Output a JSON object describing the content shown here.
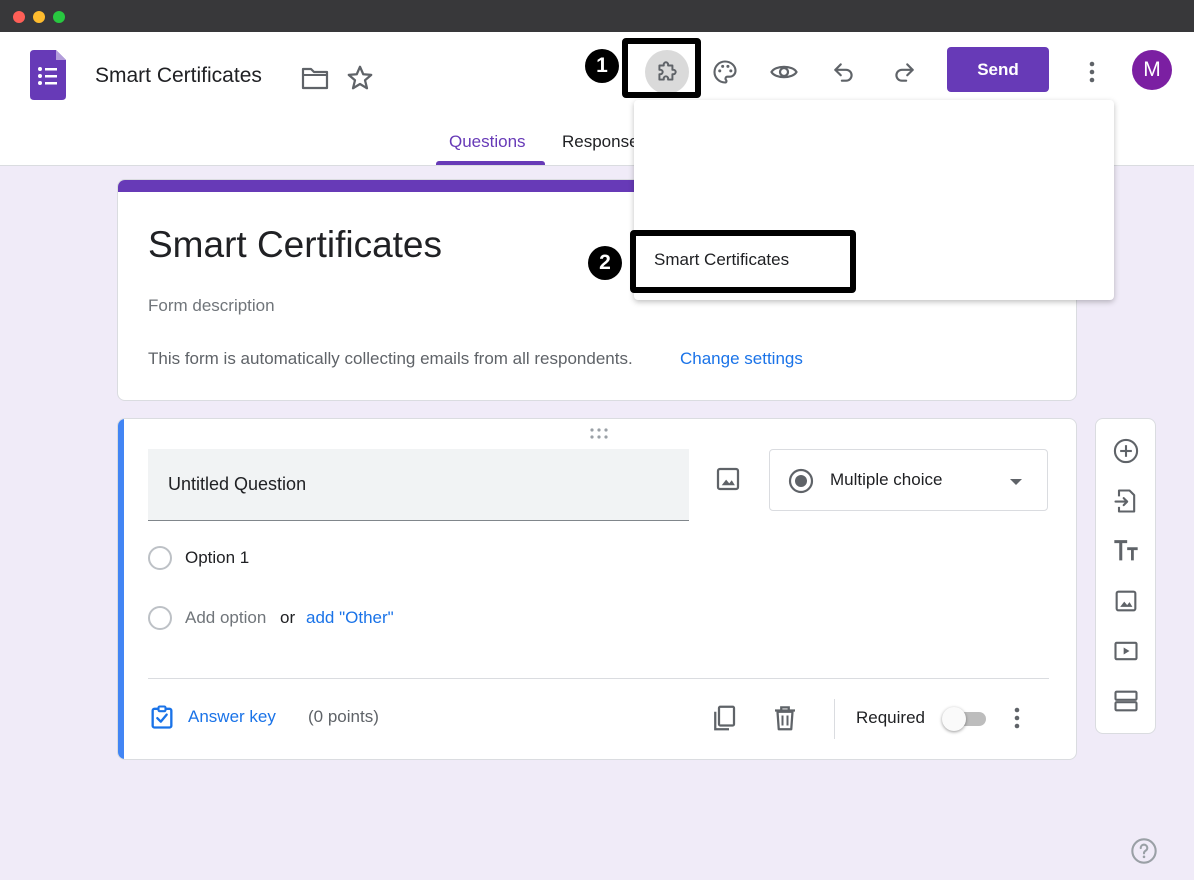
{
  "document": {
    "title": "Smart Certificates"
  },
  "toolbar": {
    "send_label": "Send",
    "avatar_letter": "M"
  },
  "tabs": [
    {
      "label": "Questions",
      "active": true
    },
    {
      "label": "Responses",
      "active": false
    }
  ],
  "annotations": {
    "step1": "1",
    "step2": "2"
  },
  "addon_menu": {
    "items": [
      "Smart Certificates"
    ]
  },
  "form": {
    "title": "Smart Certificates",
    "description_placeholder": "Form description",
    "collect_notice": "This form is automatically collecting emails from all respondents.",
    "change_settings": "Change settings"
  },
  "question": {
    "title": "Untitled Question",
    "type": "Multiple choice",
    "options": [
      "Option 1"
    ],
    "add_option": "Add option",
    "or_text": "or",
    "add_other": "add \"Other\"",
    "answer_key": "Answer key",
    "points": "(0 points)",
    "required_label": "Required",
    "required": false
  },
  "colors": {
    "brand_purple": "#673ab7",
    "background": "#f0ebf8",
    "link_blue": "#1a73e8",
    "active_card_bar": "#4285f4",
    "avatar": "#7b1fa2"
  },
  "icons": [
    "forms-logo-icon",
    "folder-icon",
    "star-icon",
    "addon-puzzle-icon",
    "palette-icon",
    "preview-eye-icon",
    "undo-icon",
    "redo-icon",
    "more-vert-icon",
    "drag-handle-icon",
    "image-icon",
    "radio-icon",
    "dropdown-caret-icon",
    "answer-key-icon",
    "copy-icon",
    "trash-icon",
    "add-circle-icon",
    "import-icon",
    "title-icon",
    "add-image-icon",
    "video-icon",
    "section-icon",
    "help-icon"
  ]
}
